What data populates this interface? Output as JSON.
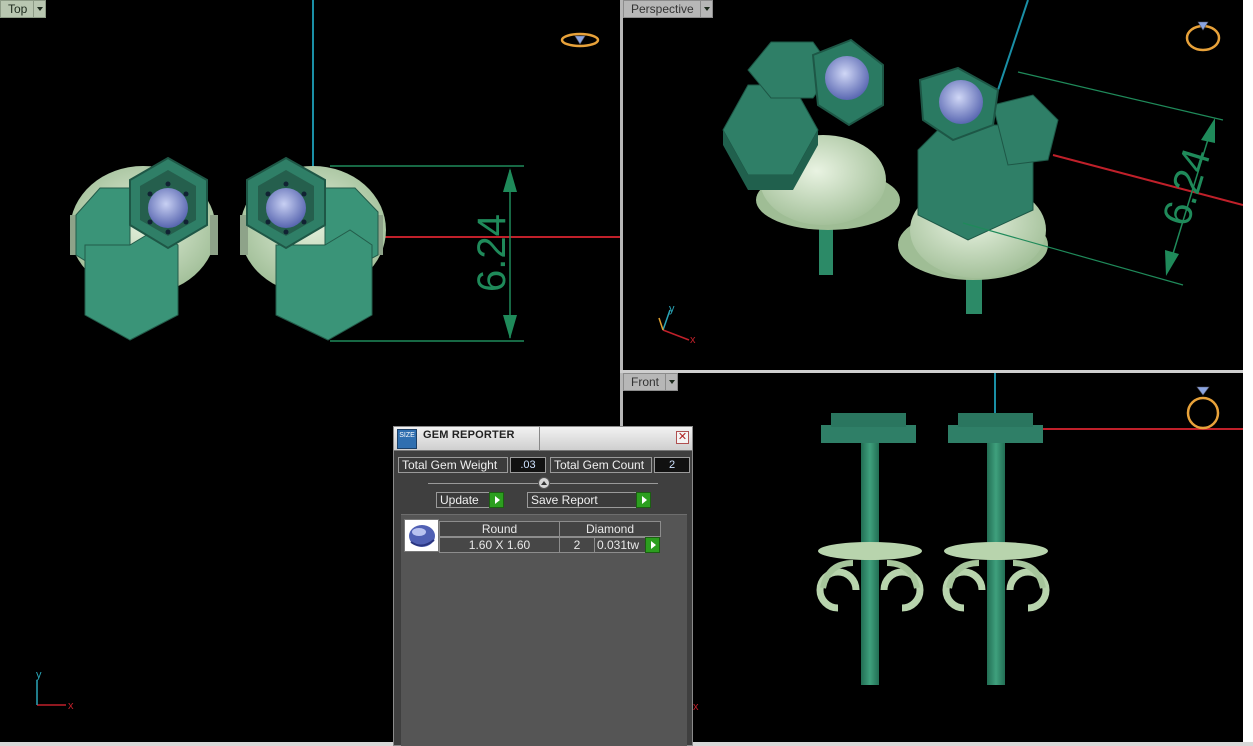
{
  "viewports": {
    "top": {
      "label": "Top",
      "dimension": "6.24",
      "axis_x": "x",
      "axis_y": "y"
    },
    "perspective": {
      "label": "Perspective",
      "dimension": "6.24",
      "axis_x": "x",
      "axis_y": "y"
    },
    "front": {
      "label": "Front",
      "axis_x": "x"
    }
  },
  "gem_reporter": {
    "logo_text": "SIZE",
    "title": "GEM REPORTER",
    "close_label": "✕",
    "total_weight_label": "Total Gem Weight",
    "total_weight_value": ".03",
    "total_count_label": "Total Gem Count",
    "total_count_value": "2",
    "update_label": "Update",
    "save_report_label": "Save Report",
    "columns": {
      "shape": "Round",
      "type": "Diamond"
    },
    "rows": [
      {
        "size": "1.60 X 1.60",
        "count": "2",
        "weight": "0.031tw"
      }
    ]
  },
  "colors": {
    "metal_green": "#2f8a6b",
    "metal_light": "#b8d4ad",
    "gem": "#7b86c8",
    "accent_go": "#2c9e1f",
    "axis_x": "#c0202a",
    "axis_z": "#1a8fa6",
    "dimension": "#1f8a5a"
  },
  "icons": [
    "ring-view-icon",
    "gem-thumbnail-icon",
    "go-arrow-icon",
    "dropdown-arrow-icon"
  ]
}
